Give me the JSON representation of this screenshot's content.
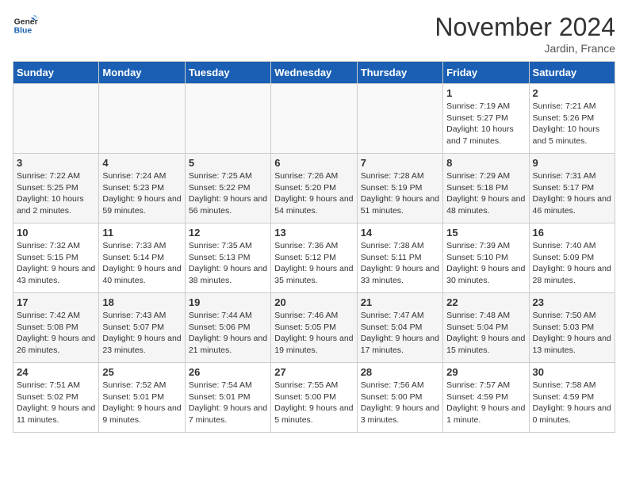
{
  "logo": {
    "line1": "General",
    "line2": "Blue"
  },
  "title": "November 2024",
  "location": "Jardin, France",
  "days_of_week": [
    "Sunday",
    "Monday",
    "Tuesday",
    "Wednesday",
    "Thursday",
    "Friday",
    "Saturday"
  ],
  "weeks": [
    [
      {
        "day": "",
        "info": ""
      },
      {
        "day": "",
        "info": ""
      },
      {
        "day": "",
        "info": ""
      },
      {
        "day": "",
        "info": ""
      },
      {
        "day": "",
        "info": ""
      },
      {
        "day": "1",
        "info": "Sunrise: 7:19 AM\nSunset: 5:27 PM\nDaylight: 10 hours and 7 minutes."
      },
      {
        "day": "2",
        "info": "Sunrise: 7:21 AM\nSunset: 5:26 PM\nDaylight: 10 hours and 5 minutes."
      }
    ],
    [
      {
        "day": "3",
        "info": "Sunrise: 7:22 AM\nSunset: 5:25 PM\nDaylight: 10 hours and 2 minutes."
      },
      {
        "day": "4",
        "info": "Sunrise: 7:24 AM\nSunset: 5:23 PM\nDaylight: 9 hours and 59 minutes."
      },
      {
        "day": "5",
        "info": "Sunrise: 7:25 AM\nSunset: 5:22 PM\nDaylight: 9 hours and 56 minutes."
      },
      {
        "day": "6",
        "info": "Sunrise: 7:26 AM\nSunset: 5:20 PM\nDaylight: 9 hours and 54 minutes."
      },
      {
        "day": "7",
        "info": "Sunrise: 7:28 AM\nSunset: 5:19 PM\nDaylight: 9 hours and 51 minutes."
      },
      {
        "day": "8",
        "info": "Sunrise: 7:29 AM\nSunset: 5:18 PM\nDaylight: 9 hours and 48 minutes."
      },
      {
        "day": "9",
        "info": "Sunrise: 7:31 AM\nSunset: 5:17 PM\nDaylight: 9 hours and 46 minutes."
      }
    ],
    [
      {
        "day": "10",
        "info": "Sunrise: 7:32 AM\nSunset: 5:15 PM\nDaylight: 9 hours and 43 minutes."
      },
      {
        "day": "11",
        "info": "Sunrise: 7:33 AM\nSunset: 5:14 PM\nDaylight: 9 hours and 40 minutes."
      },
      {
        "day": "12",
        "info": "Sunrise: 7:35 AM\nSunset: 5:13 PM\nDaylight: 9 hours and 38 minutes."
      },
      {
        "day": "13",
        "info": "Sunrise: 7:36 AM\nSunset: 5:12 PM\nDaylight: 9 hours and 35 minutes."
      },
      {
        "day": "14",
        "info": "Sunrise: 7:38 AM\nSunset: 5:11 PM\nDaylight: 9 hours and 33 minutes."
      },
      {
        "day": "15",
        "info": "Sunrise: 7:39 AM\nSunset: 5:10 PM\nDaylight: 9 hours and 30 minutes."
      },
      {
        "day": "16",
        "info": "Sunrise: 7:40 AM\nSunset: 5:09 PM\nDaylight: 9 hours and 28 minutes."
      }
    ],
    [
      {
        "day": "17",
        "info": "Sunrise: 7:42 AM\nSunset: 5:08 PM\nDaylight: 9 hours and 26 minutes."
      },
      {
        "day": "18",
        "info": "Sunrise: 7:43 AM\nSunset: 5:07 PM\nDaylight: 9 hours and 23 minutes."
      },
      {
        "day": "19",
        "info": "Sunrise: 7:44 AM\nSunset: 5:06 PM\nDaylight: 9 hours and 21 minutes."
      },
      {
        "day": "20",
        "info": "Sunrise: 7:46 AM\nSunset: 5:05 PM\nDaylight: 9 hours and 19 minutes."
      },
      {
        "day": "21",
        "info": "Sunrise: 7:47 AM\nSunset: 5:04 PM\nDaylight: 9 hours and 17 minutes."
      },
      {
        "day": "22",
        "info": "Sunrise: 7:48 AM\nSunset: 5:04 PM\nDaylight: 9 hours and 15 minutes."
      },
      {
        "day": "23",
        "info": "Sunrise: 7:50 AM\nSunset: 5:03 PM\nDaylight: 9 hours and 13 minutes."
      }
    ],
    [
      {
        "day": "24",
        "info": "Sunrise: 7:51 AM\nSunset: 5:02 PM\nDaylight: 9 hours and 11 minutes."
      },
      {
        "day": "25",
        "info": "Sunrise: 7:52 AM\nSunset: 5:01 PM\nDaylight: 9 hours and 9 minutes."
      },
      {
        "day": "26",
        "info": "Sunrise: 7:54 AM\nSunset: 5:01 PM\nDaylight: 9 hours and 7 minutes."
      },
      {
        "day": "27",
        "info": "Sunrise: 7:55 AM\nSunset: 5:00 PM\nDaylight: 9 hours and 5 minutes."
      },
      {
        "day": "28",
        "info": "Sunrise: 7:56 AM\nSunset: 5:00 PM\nDaylight: 9 hours and 3 minutes."
      },
      {
        "day": "29",
        "info": "Sunrise: 7:57 AM\nSunset: 4:59 PM\nDaylight: 9 hours and 1 minute."
      },
      {
        "day": "30",
        "info": "Sunrise: 7:58 AM\nSunset: 4:59 PM\nDaylight: 9 hours and 0 minutes."
      }
    ]
  ]
}
